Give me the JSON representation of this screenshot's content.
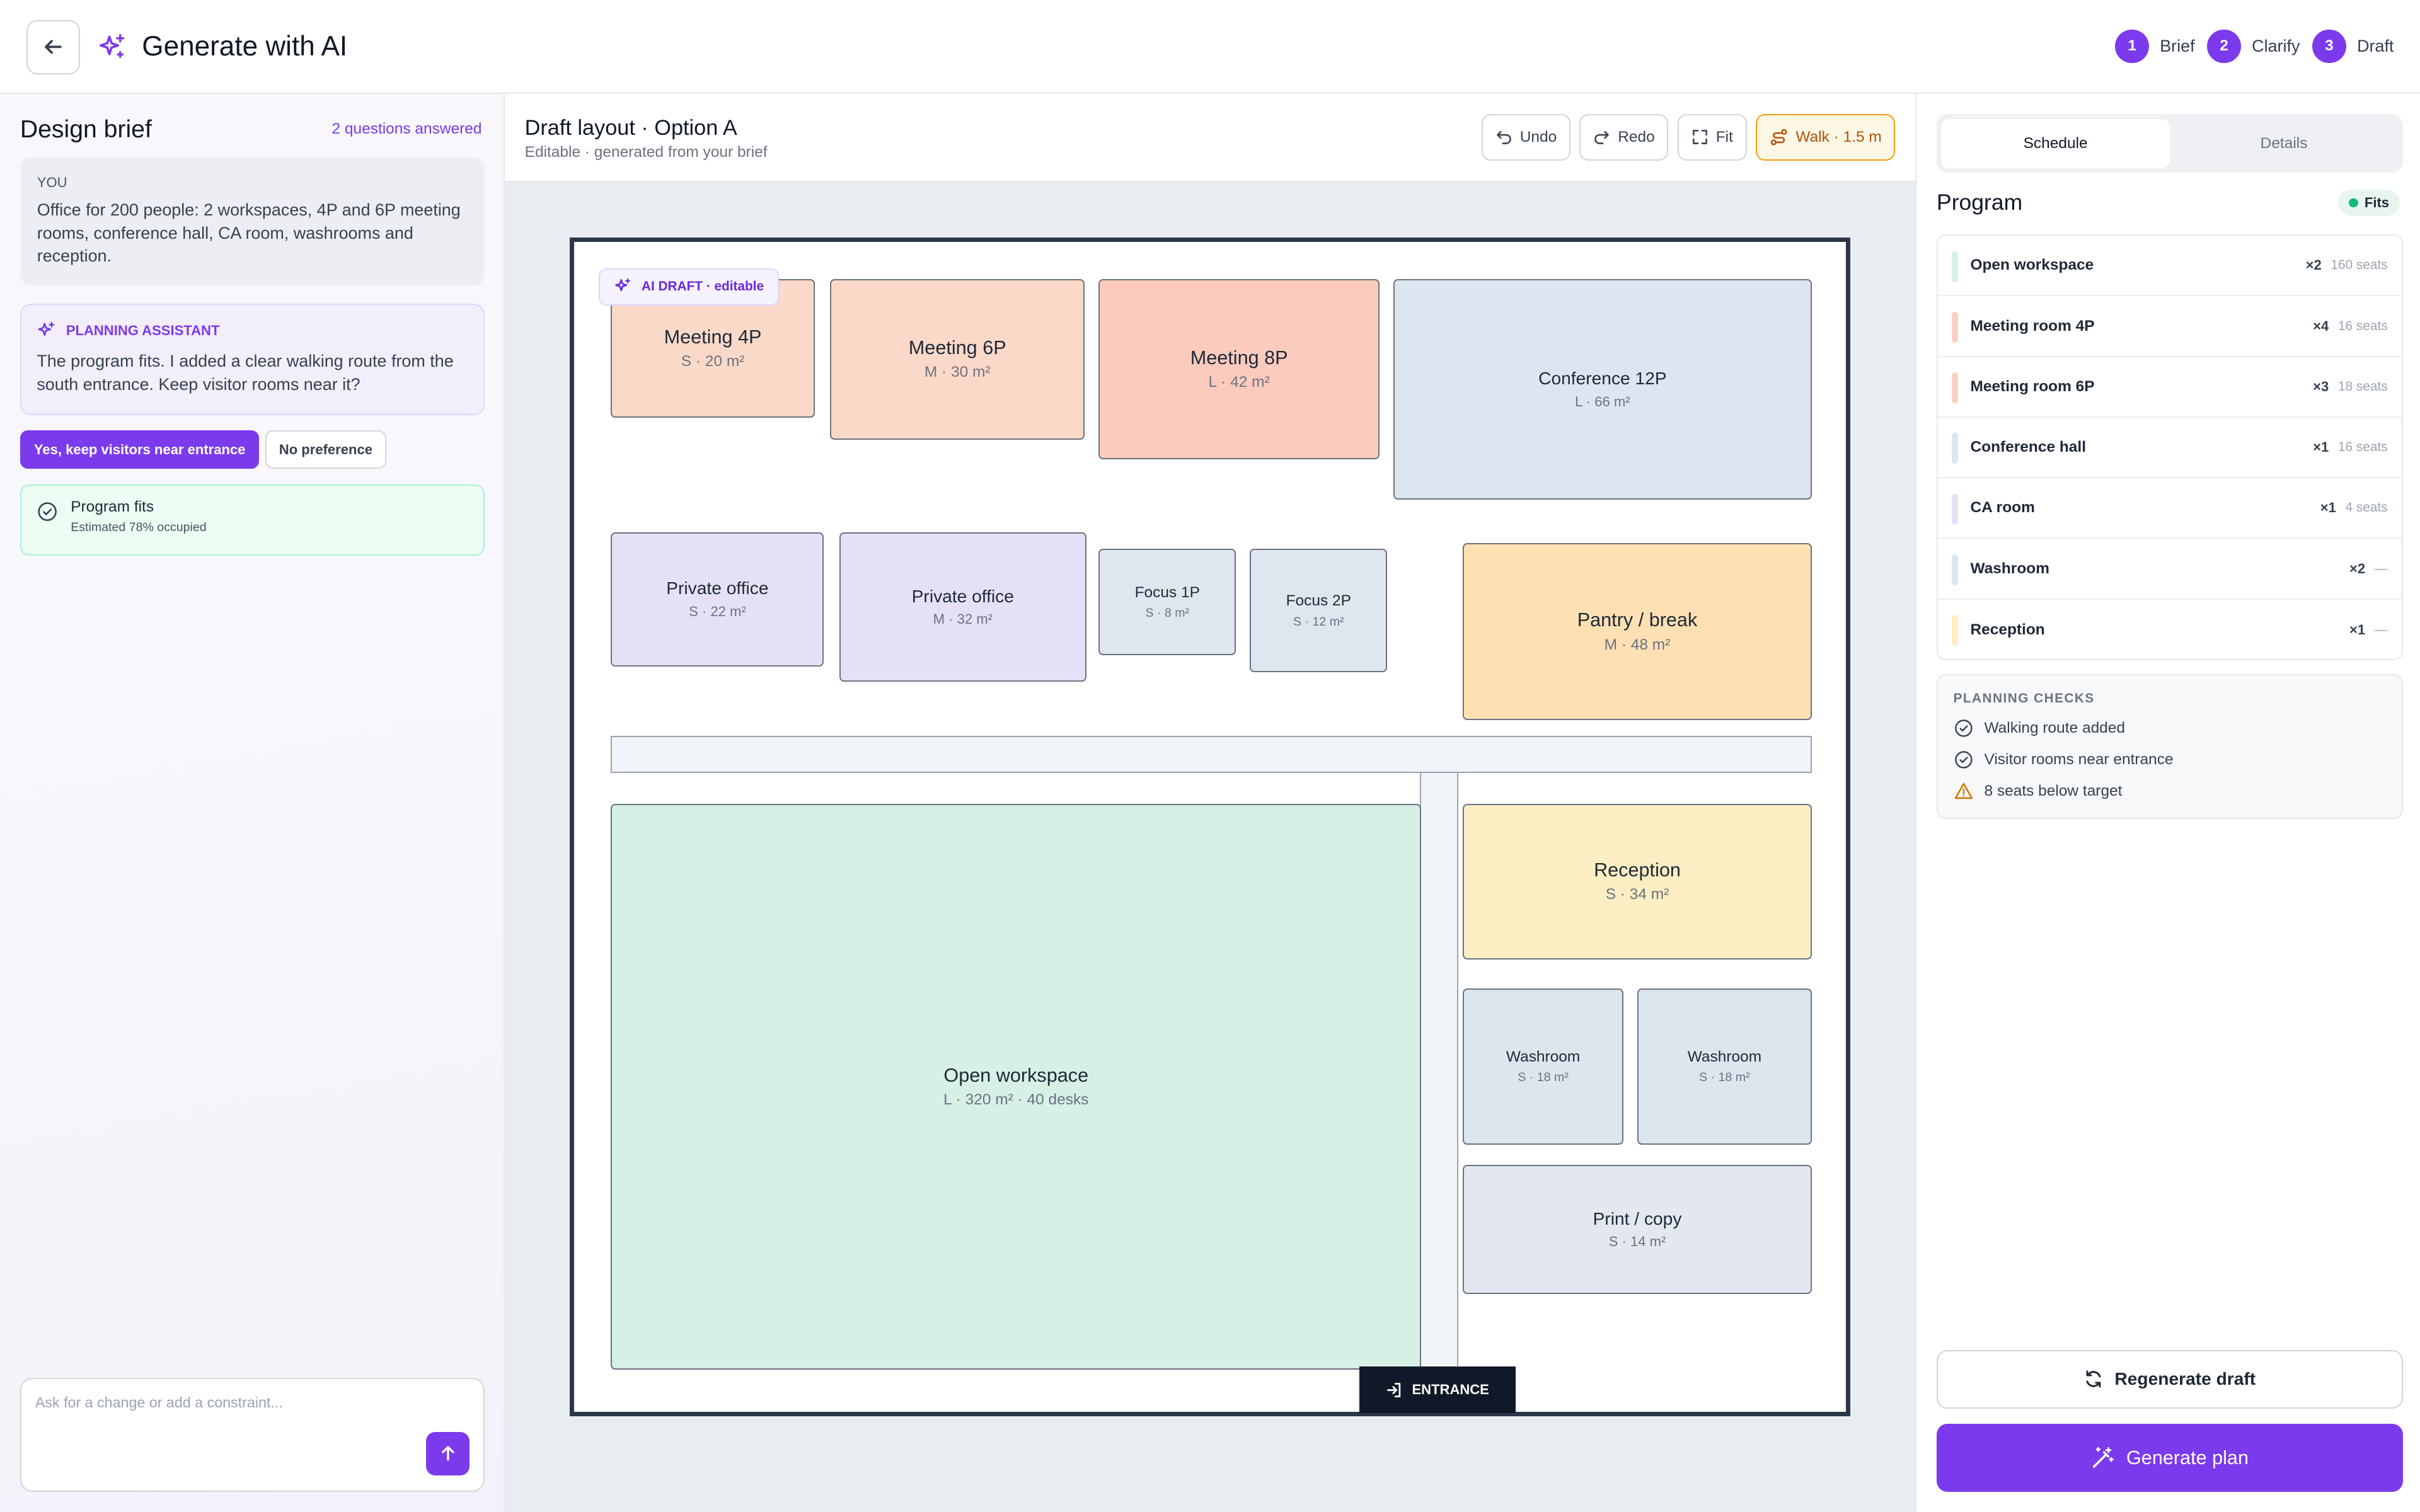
{
  "header": {
    "title": "Generate with AI",
    "steps": [
      {
        "num": "1",
        "label": "Brief"
      },
      {
        "num": "2",
        "label": "Clarify"
      },
      {
        "num": "3",
        "label": "Draft"
      }
    ]
  },
  "left": {
    "title": "Design brief",
    "answered": "2 questions answered",
    "user_label": "YOU",
    "user_msg": "Office for 200 people: 2 workspaces, 4P and 6P meeting rooms, conference hall, CA room, washrooms and reception.",
    "assistant_label": "PLANNING ASSISTANT",
    "assistant_msg": "The program fits. I added a clear walking route from the south entrance. Keep visitor rooms near it?",
    "chip_yes": "Yes, keep visitors near entrance",
    "chip_no": "No preference",
    "fits_title": "Program fits",
    "fits_sub": "Estimated 78% occupied",
    "input_placeholder": "Ask for a change or add a constraint..."
  },
  "center": {
    "title": "Draft layout · Option A",
    "subtitle": "Editable · generated from your brief",
    "tools": {
      "undo": "Undo",
      "redo": "Redo",
      "fit": "Fit",
      "walk": "Walk · 1.5 m"
    },
    "badge": "AI DRAFT · editable",
    "entrance": "ENTRANCE",
    "rooms": {
      "m4": {
        "name": "Meeting 4P",
        "size": "S · 20 m²"
      },
      "m6": {
        "name": "Meeting 6P",
        "size": "M · 30 m²"
      },
      "m8": {
        "name": "Meeting 8P",
        "size": "L · 42 m²"
      },
      "conf": {
        "name": "Conference 12P",
        "size": "L · 66 m²"
      },
      "po1": {
        "name": "Private office",
        "size": "S · 22 m²"
      },
      "po2": {
        "name": "Private office",
        "size": "M · 32 m²"
      },
      "f1": {
        "name": "Focus 1P",
        "size": "S · 8 m²"
      },
      "f2": {
        "name": "Focus 2P",
        "size": "S · 12 m²"
      },
      "pantry": {
        "name": "Pantry / break",
        "size": "M · 48 m²"
      },
      "open": {
        "name": "Open workspace",
        "size": "L · 320 m² · 40 desks"
      },
      "rec": {
        "name": "Reception",
        "size": "S · 34 m²"
      },
      "w1": {
        "name": "Washroom",
        "size": "S · 18 m²"
      },
      "w2": {
        "name": "Washroom",
        "size": "S · 18 m²"
      },
      "print": {
        "name": "Print / copy",
        "size": "S · 14 m²"
      }
    }
  },
  "right": {
    "tabs": [
      "Schedule",
      "Details"
    ],
    "program_title": "Program",
    "fits_badge": "Fits",
    "items": [
      {
        "name": "Open workspace",
        "count": "×2",
        "seats": "160 seats",
        "color": "#d6f0e5"
      },
      {
        "name": "Meeting room 4P",
        "count": "×4",
        "seats": "16 seats",
        "color": "#fbd0c4"
      },
      {
        "name": "Meeting room 6P",
        "count": "×3",
        "seats": "18 seats",
        "color": "#fbd0c4"
      },
      {
        "name": "Conference hall",
        "count": "×1",
        "seats": "16 seats",
        "color": "#dbe6f2"
      },
      {
        "name": "CA room",
        "count": "×1",
        "seats": "4 seats",
        "color": "#e6e0f7"
      },
      {
        "name": "Washroom",
        "count": "×2",
        "seats": "—",
        "color": "#dbe6f2"
      },
      {
        "name": "Reception",
        "count": "×1",
        "seats": "—",
        "color": "#fdeec0"
      }
    ],
    "checks_title": "PLANNING CHECKS",
    "checks": [
      "Walking route added",
      "Visitor rooms near entrance",
      "8 seats below target"
    ],
    "regen": "Regenerate draft",
    "generate": "Generate plan"
  }
}
